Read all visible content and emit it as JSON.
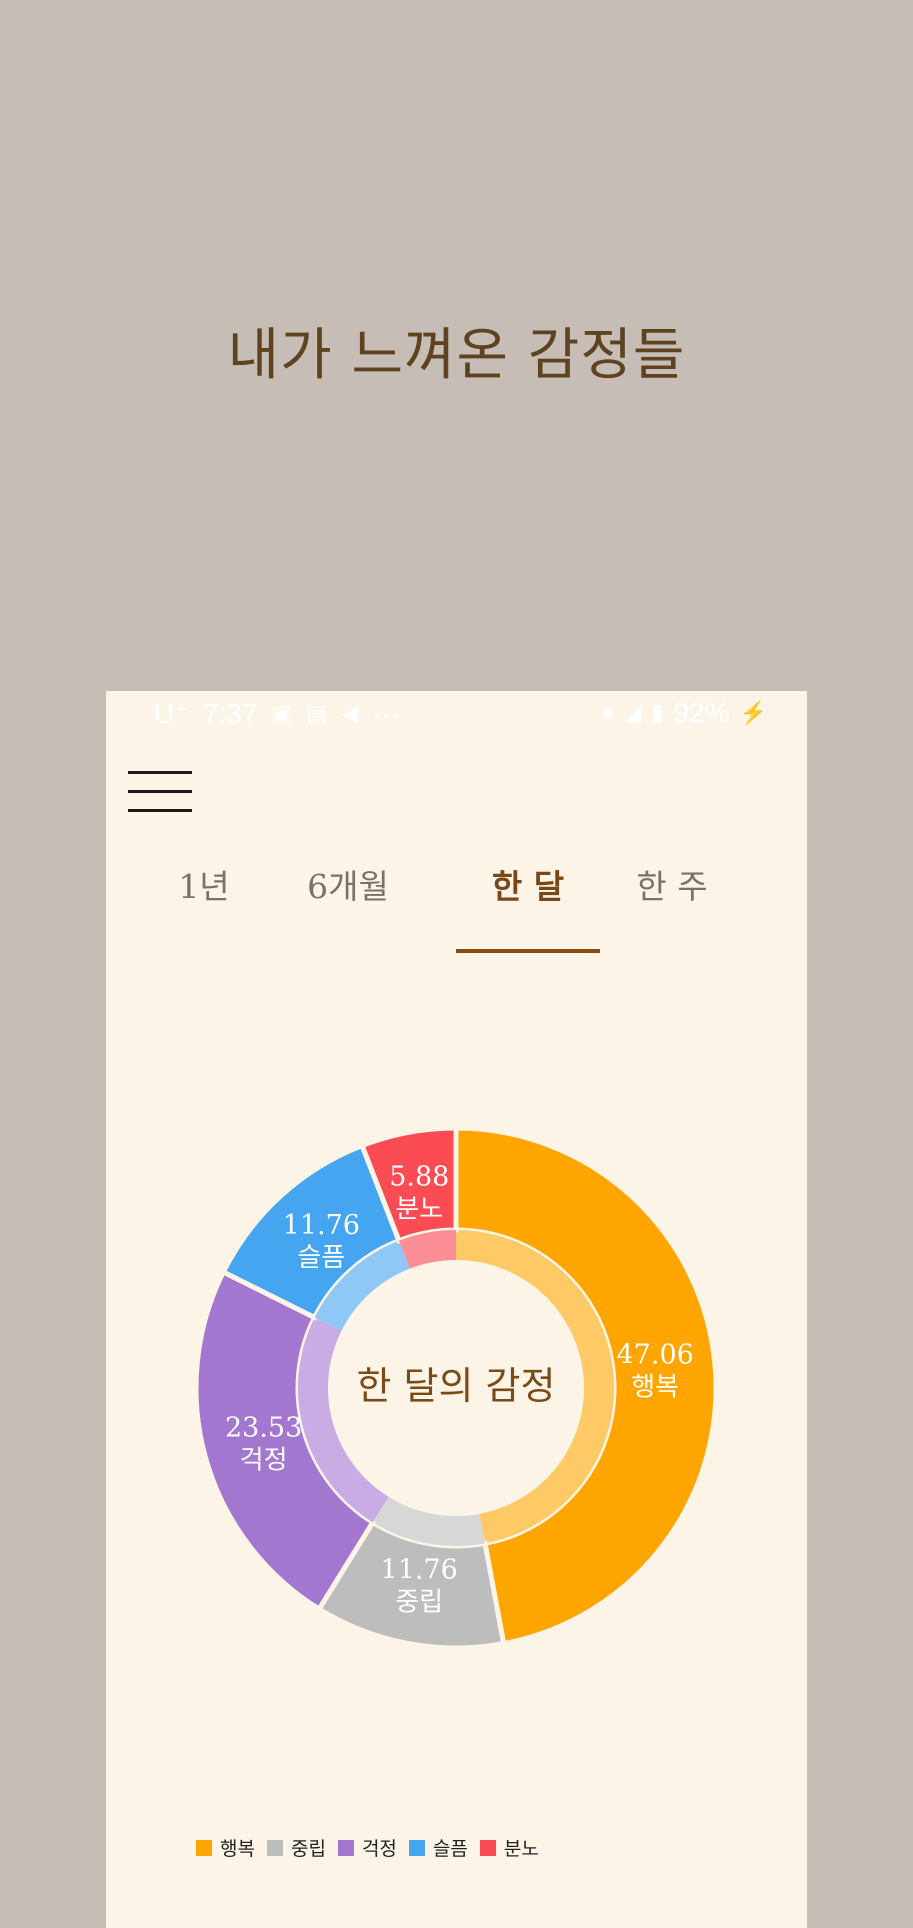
{
  "page": {
    "title": "내가 느껴온 감정들"
  },
  "statusbar": {
    "time": "7:37",
    "left_extra": "U⁺",
    "dots": "···",
    "battery": "92%"
  },
  "tabs": [
    {
      "label": "1년",
      "active": false
    },
    {
      "label": "6개월",
      "active": false
    },
    {
      "label": "한 달",
      "active": true
    },
    {
      "label": "한 주",
      "active": false
    }
  ],
  "chart_data": {
    "type": "donut",
    "center_label": "한 달의 감정",
    "series": [
      {
        "name": "행복",
        "value": 47.06,
        "color": "#ffa500",
        "inner_color": "#ffc966"
      },
      {
        "name": "중립",
        "value": 11.76,
        "color": "#bdbdbd",
        "inner_color": "#d7d7d7"
      },
      {
        "name": "걱정",
        "value": 23.53,
        "color": "#a376cf",
        "inner_color": "#c8ace3"
      },
      {
        "name": "슬픔",
        "value": 11.76,
        "color": "#45a5f1",
        "inner_color": "#8fc8f7"
      },
      {
        "name": "분노",
        "value": 5.88,
        "color": "#fb4c56",
        "inner_color": "#fc8f95"
      }
    ],
    "value_labels": [
      "47.06",
      "11.76",
      "23.53",
      "11.76",
      "5.88"
    ],
    "legend": [
      "행복",
      "중립",
      "걱정",
      "슬픔",
      "분노"
    ]
  }
}
